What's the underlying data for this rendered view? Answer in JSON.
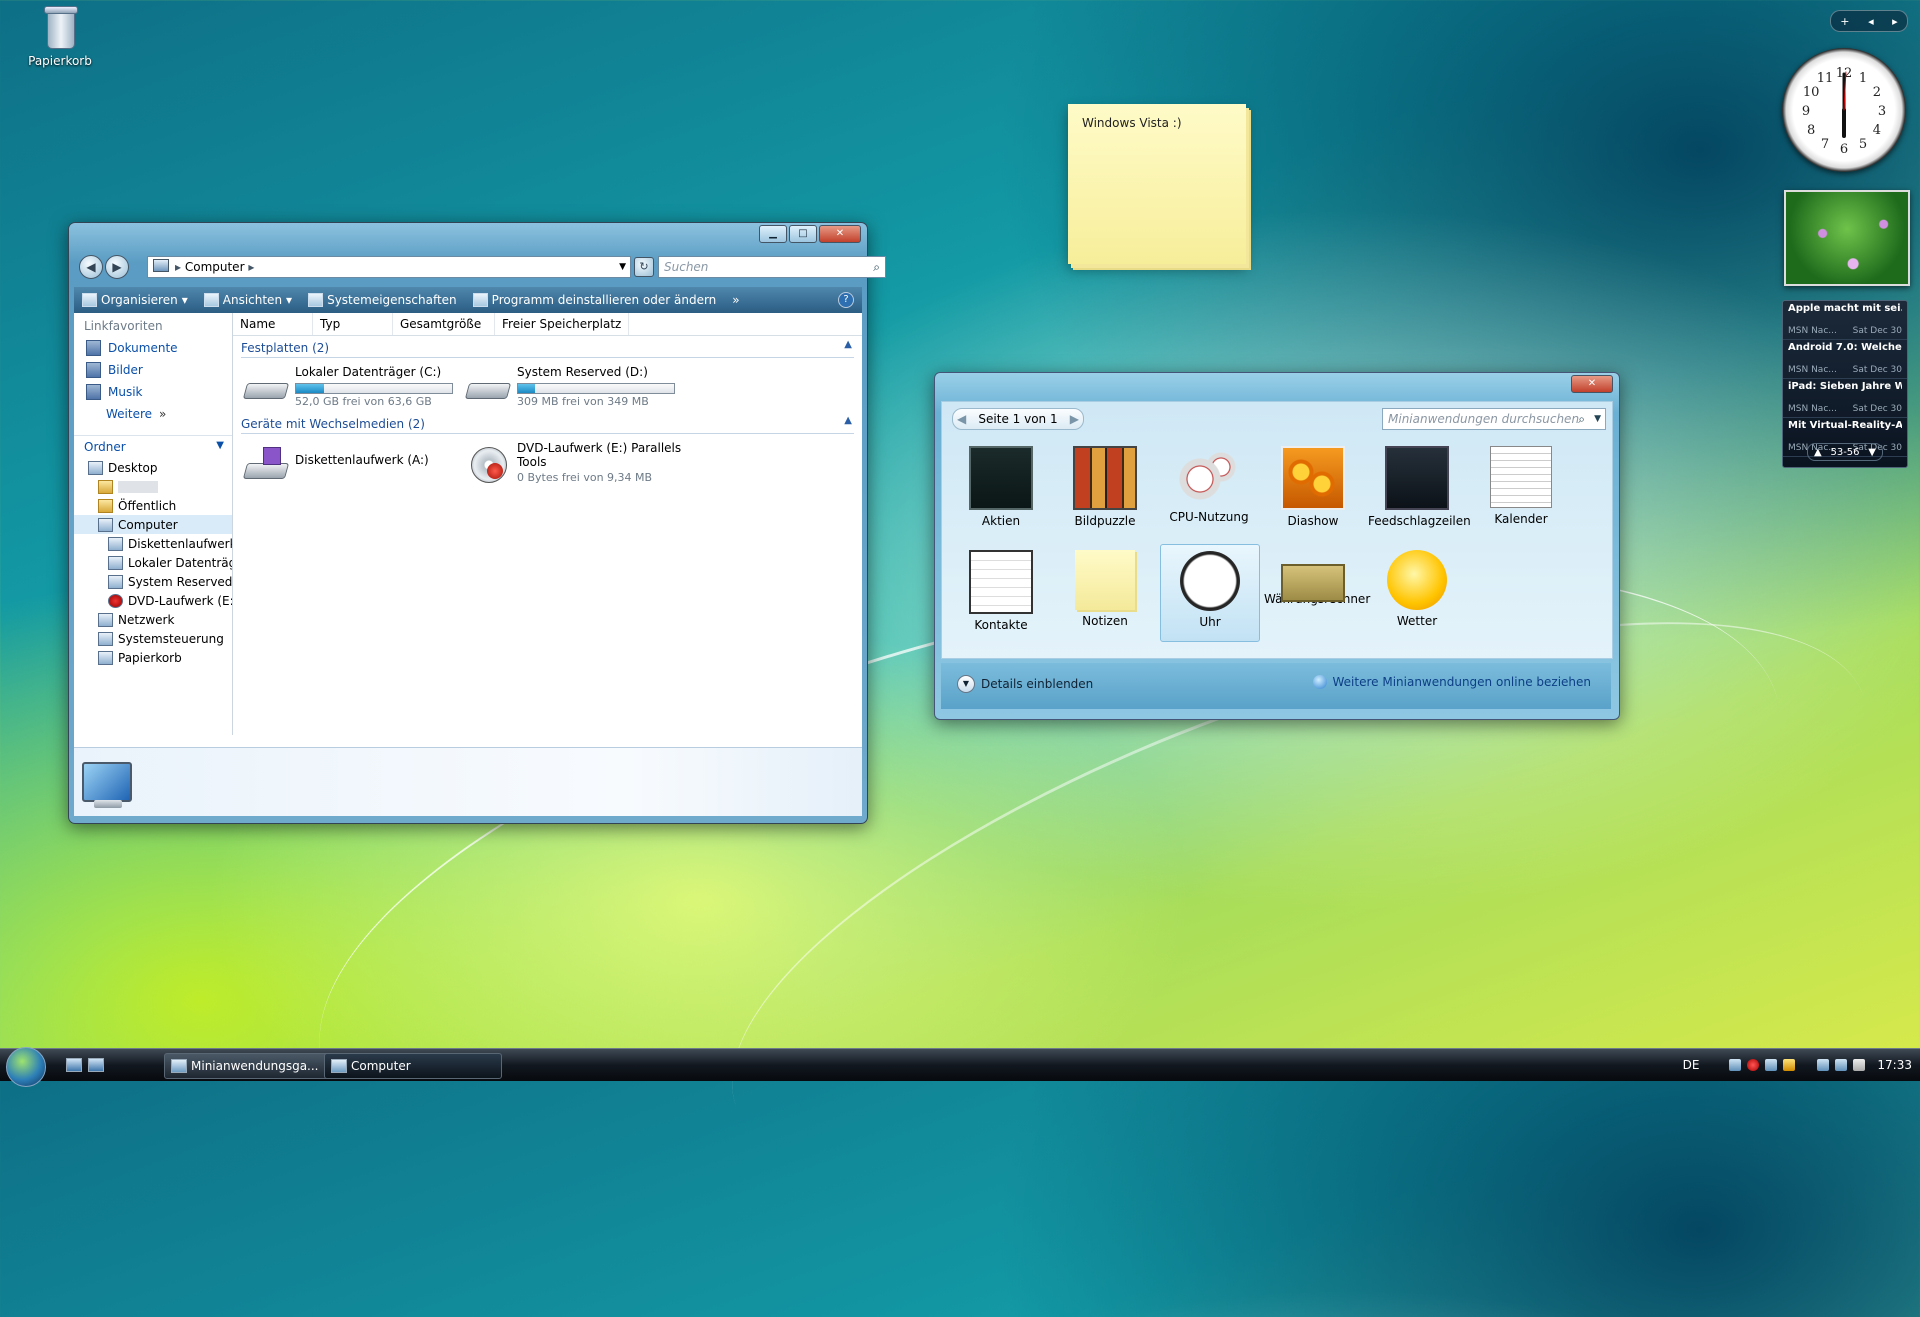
{
  "desktop": {
    "icons": [
      {
        "label": "Papierkorb",
        "icon": "recycle-bin-icon"
      }
    ]
  },
  "explorer": {
    "address": "Computer",
    "search_placeholder": "Suchen",
    "toolbar": {
      "organize": "Organisieren",
      "views": "Ansichten",
      "system_properties": "Systemeigenschaften",
      "uninstall": "Programm deinstallieren oder ändern",
      "more": "»"
    },
    "nav": {
      "favorites_header": "Linkfavoriten",
      "favorites": [
        "Dokumente",
        "Bilder",
        "Musik"
      ],
      "more_label": "Weitere",
      "folders_header": "Ordner",
      "tree": [
        "Desktop",
        "",
        "Öffentlich",
        "Computer",
        "Diskettenlaufwerk",
        "Lokaler Datenträg",
        "System Reserved (",
        "DVD-Laufwerk (E:",
        "Netzwerk",
        "Systemsteuerung",
        "Papierkorb"
      ]
    },
    "columns": [
      "Name",
      "Typ",
      "Gesamtgröße",
      "Freier Speicherplatz"
    ],
    "groups": {
      "hard_disks": "Festplatten (2)",
      "removable": "Geräte mit Wechselmedien (2)"
    },
    "drives": [
      {
        "name": "Lokaler Datenträger (C:)",
        "free": "52,0 GB frei von 63,6 GB",
        "used_fraction": 0.18
      },
      {
        "name": "System Reserved (D:)",
        "free": "309 MB frei von 349 MB",
        "used_fraction": 0.11
      }
    ],
    "removable": [
      {
        "name": "Diskettenlaufwerk (A:)"
      },
      {
        "name": "DVD-Laufwerk (E:) Parallels",
        "name2": "Tools",
        "free": "0 Bytes frei von 9,34 MB"
      }
    ]
  },
  "note": {
    "text": "Windows Vista :)"
  },
  "gallery": {
    "page": "Seite 1 von 1",
    "search_placeholder": "Minianwendungen durchsuchen",
    "gadgets": [
      "Aktien",
      "Bildpuzzle",
      "CPU-Nutzung",
      "Diashow",
      "Feedschlagzeilen",
      "Kalender",
      "Kontakte",
      "Notizen",
      "Uhr",
      "Währungsrechner",
      "Wetter"
    ],
    "selected": "Uhr",
    "details": "Details einblenden",
    "online": "Weitere Minianwendungen online beziehen"
  },
  "sidebar": {
    "feeds": [
      {
        "title": "Apple macht mit sei...",
        "source": "MSN Nac...",
        "date": "Sat Dec 30"
      },
      {
        "title": "Android 7.0: Welche ...",
        "source": "MSN Nac...",
        "date": "Sat Dec 30"
      },
      {
        "title": "iPad: Sieben Jahre W...",
        "source": "MSN Nac...",
        "date": "Sat Dec 30"
      },
      {
        "title": "Mit Virtual-Reality-A...",
        "source": "MSN Nac...",
        "date": "Sat Dec 30"
      }
    ],
    "feed_range": "53-56",
    "clock": {
      "hour": 6,
      "minute": 0
    }
  },
  "taskbar": {
    "buttons": [
      "Minianwendungsga...",
      "Computer"
    ],
    "language": "DE",
    "time": "17:33"
  }
}
